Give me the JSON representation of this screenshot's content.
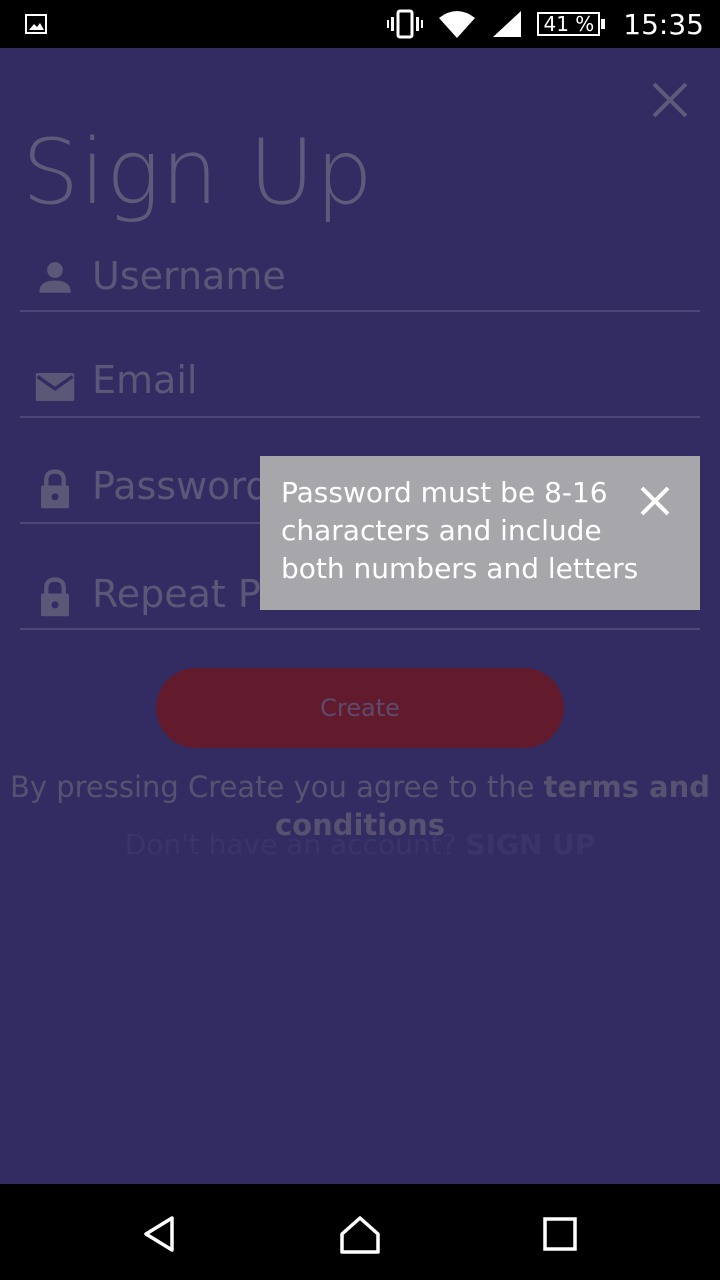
{
  "status_bar": {
    "left_icon": "gallery-notification-icon",
    "icons": [
      "vibrate-icon",
      "wifi-icon",
      "signal-icon"
    ],
    "battery": "41 %",
    "time": "15:35"
  },
  "header": {
    "title": "Sign Up",
    "close_icon": "close-icon"
  },
  "form": {
    "fields": [
      {
        "placeholder": "Username",
        "icon": "person-icon"
      },
      {
        "placeholder": "Email",
        "icon": "mail-icon"
      },
      {
        "placeholder": "Password",
        "icon": "lock-icon"
      },
      {
        "placeholder": "Repeat Password",
        "icon": "lock-icon"
      }
    ],
    "create_label": "Create"
  },
  "terms": {
    "prefix": "By pressing Create you agree to the ",
    "link": "terms and conditions"
  },
  "account": {
    "prefix": "Don't have an account? ",
    "link": "SIGN UP"
  },
  "popup": {
    "message": "Password must be 8-16 characters and include both numbers and letters",
    "close_icon": "close-icon"
  },
  "nav_bar": {
    "buttons": [
      "back-icon",
      "home-icon",
      "recents-icon"
    ]
  },
  "colors": {
    "background": "#322C63",
    "button": "#611B2C",
    "popup": "#A7A6AA"
  }
}
